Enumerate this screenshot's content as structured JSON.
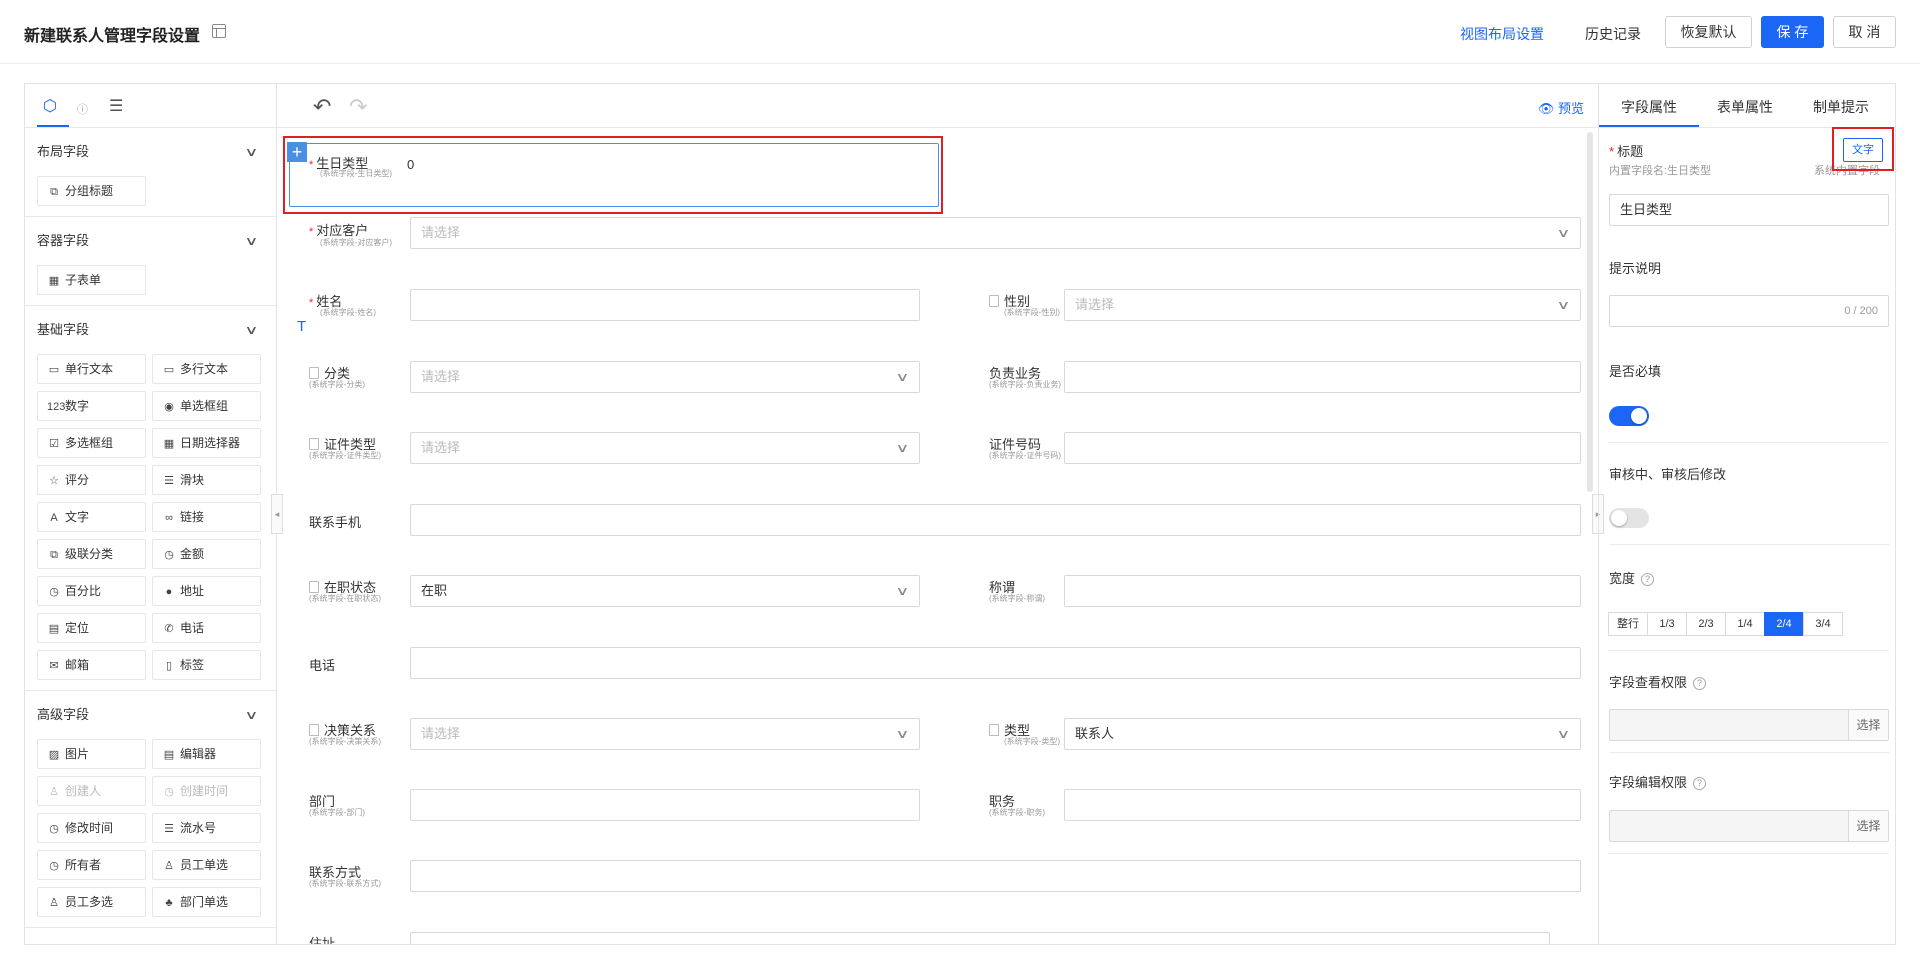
{
  "header": {
    "title": "新建联系人管理字段设置",
    "view_layout": "视图布局设置",
    "history": "历史记录",
    "restore_default": "恢复默认",
    "save": "保 存",
    "cancel": "取 消",
    "accent": "#1b66f5"
  },
  "left_panel": {
    "sections": [
      {
        "title": "布局字段",
        "items": [
          {
            "icon": "⧉",
            "label": "分组标题"
          }
        ]
      },
      {
        "title": "容器字段",
        "items": [
          {
            "icon": "▦",
            "label": "子表单"
          }
        ]
      },
      {
        "title": "基础字段",
        "items": [
          {
            "icon": "▭",
            "label": "单行文本"
          },
          {
            "icon": "▭",
            "label": "多行文本"
          },
          {
            "icon": "123",
            "label": "数字"
          },
          {
            "icon": "◉",
            "label": "单选框组"
          },
          {
            "icon": "☑",
            "label": "多选框组"
          },
          {
            "icon": "▦",
            "label": "日期选择器"
          },
          {
            "icon": "☆",
            "label": "评分"
          },
          {
            "icon": "☰",
            "label": "滑块"
          },
          {
            "icon": "A",
            "label": "文字"
          },
          {
            "icon": "∞",
            "label": "链接"
          },
          {
            "icon": "⧉",
            "label": "级联分类"
          },
          {
            "icon": "◷",
            "label": "金额"
          },
          {
            "icon": "◷",
            "label": "百分比"
          },
          {
            "icon": "●",
            "label": "地址"
          },
          {
            "icon": "▤",
            "label": "定位"
          },
          {
            "icon": "✆",
            "label": "电话"
          },
          {
            "icon": "✉",
            "label": "邮箱"
          },
          {
            "icon": "▯",
            "label": "标签"
          }
        ]
      },
      {
        "title": "高级字段",
        "items": [
          {
            "icon": "▨",
            "label": "图片"
          },
          {
            "icon": "▤",
            "label": "编辑器"
          },
          {
            "icon": "♙",
            "label": "创建人",
            "disabled": true
          },
          {
            "icon": "◷",
            "label": "创建时间",
            "disabled": true
          },
          {
            "icon": "◷",
            "label": "修改时间"
          },
          {
            "icon": "☰",
            "label": "流水号"
          },
          {
            "icon": "◷",
            "label": "所有者"
          },
          {
            "icon": "♙",
            "label": "员工单选"
          },
          {
            "icon": "♙",
            "label": "员工多选"
          },
          {
            "icon": "♣",
            "label": "部门单选"
          }
        ]
      }
    ]
  },
  "canvas": {
    "preview": "预览",
    "selected": {
      "label": "生日类型",
      "sub": "(系统字段-生日类型)",
      "value": "0"
    },
    "fields": {
      "customer": {
        "label": "对应客户",
        "sub": "(系统字段-对应客户)",
        "placeholder": "请选择"
      },
      "name": {
        "label": "姓名",
        "sub": "(系统字段-姓名)"
      },
      "gender": {
        "label": "性别",
        "sub": "(系统字段-性别)",
        "placeholder": "请选择"
      },
      "category": {
        "label": "分类",
        "sub": "(系统字段-分类)",
        "placeholder": "请选择"
      },
      "business": {
        "label": "负责业务",
        "sub": "(系统字段-负责业务)"
      },
      "id_type": {
        "label": "证件类型",
        "sub": "(系统字段-证件类型)",
        "placeholder": "请选择"
      },
      "id_no": {
        "label": "证件号码",
        "sub": "(系统字段-证件号码)"
      },
      "mobile": {
        "label": "联系手机"
      },
      "job_status": {
        "label": "在职状态",
        "sub": "(系统字段-在职状态)",
        "value": "在职"
      },
      "title": {
        "label": "称谓",
        "sub": "(系统字段-称谓)"
      },
      "phone": {
        "label": "电话"
      },
      "decision": {
        "label": "决策关系",
        "sub": "(系统字段-决策关系)",
        "placeholder": "请选择"
      },
      "type": {
        "label": "类型",
        "sub": "(系统字段-类型)",
        "value": "联系人"
      },
      "dept": {
        "label": "部门",
        "sub": "(系统字段-部门)"
      },
      "post": {
        "label": "职务",
        "sub": "(系统字段-职务)"
      },
      "contact": {
        "label": "联系方式",
        "sub": "(系统字段-联系方式)"
      },
      "address": {
        "label": "住址"
      }
    }
  },
  "right_panel": {
    "tabs": [
      "字段属性",
      "表单属性",
      "制单提示"
    ],
    "title_label": "标题",
    "builtin_name": "内置字段名:生日类型",
    "system_builtin": "系统内置字段",
    "text_button": "文字",
    "title_value": "生日类型",
    "hint_label": "提示说明",
    "hint_counter": "0 / 200",
    "required_label": "是否必填",
    "review_label": "审核中、审核后修改",
    "width_label": "宽度",
    "width_options": [
      "整行",
      "1/3",
      "2/3",
      "1/4",
      "2/4",
      "3/4"
    ],
    "width_selected": "2/4",
    "view_perm_label": "字段查看权限",
    "edit_perm_label": "字段编辑权限",
    "choose": "选择",
    "required_on": true,
    "review_on": false
  }
}
